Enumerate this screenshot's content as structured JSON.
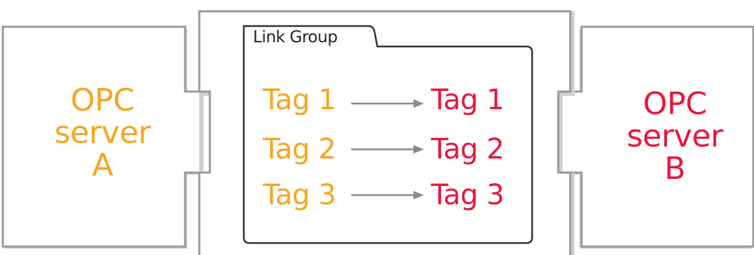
{
  "colors": {
    "server_a": "#f5a623",
    "server_b": "#e8173c",
    "frame_stroke": "#9a9a9a",
    "frame_shadow": "#cfcfcf",
    "group_stroke": "#333333",
    "arrow": "#8a8a8a"
  },
  "server_a": {
    "line1": "OPC",
    "line2": "server",
    "line3": "A"
  },
  "server_b": {
    "line1": "OPC",
    "line2": "server",
    "line3": "B"
  },
  "link_group": {
    "title": "Link Group",
    "links": [
      {
        "source": "Tag 1",
        "target": "Tag 1"
      },
      {
        "source": "Tag 2",
        "target": "Tag 2"
      },
      {
        "source": "Tag 3",
        "target": "Tag 3"
      }
    ]
  }
}
